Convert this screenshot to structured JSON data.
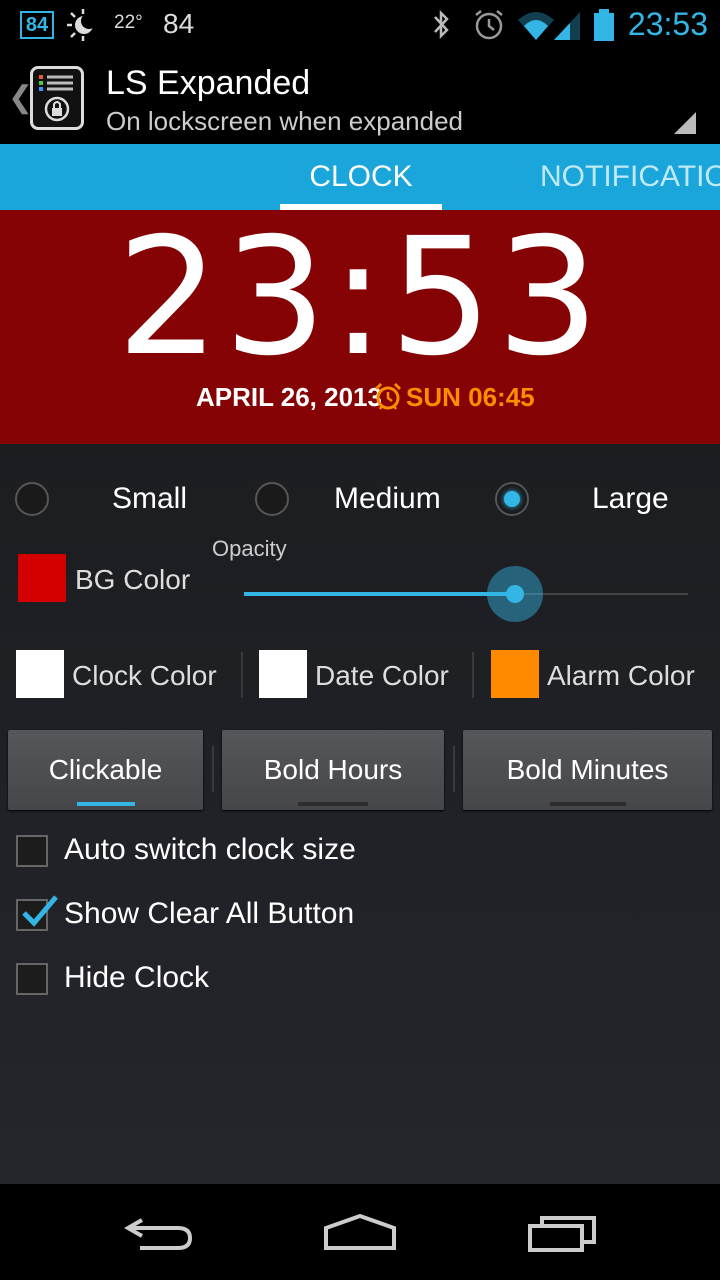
{
  "status_bar": {
    "badge": "84",
    "temperature": "22°",
    "number": "84",
    "time": "23:53",
    "icons": [
      "weather-night-icon",
      "bluetooth-icon",
      "alarm-icon",
      "wifi-icon",
      "signal-icon",
      "battery-icon"
    ]
  },
  "action_bar": {
    "title": "LS Expanded",
    "subtitle": "On lockscreen when expanded"
  },
  "tabs": [
    {
      "label": "CLOCK",
      "selected": true
    },
    {
      "label": "NOTIFICATIO",
      "selected": false
    }
  ],
  "preview": {
    "time": "23:53",
    "date": "APRIL 26, 2013",
    "alarm": "SUN 06:45",
    "bg_color": "#850305",
    "alarm_color": "#ff8c00"
  },
  "size_options": [
    {
      "label": "Small",
      "selected": false
    },
    {
      "label": "Medium",
      "selected": false
    },
    {
      "label": "Large",
      "selected": true
    }
  ],
  "bg_color": {
    "label": "BG Color",
    "swatch": "#d40000"
  },
  "opacity": {
    "label": "Opacity",
    "value": 0.61
  },
  "colors": [
    {
      "label": "Clock Color",
      "swatch": "#ffffff"
    },
    {
      "label": "Date Color",
      "swatch": "#ffffff"
    },
    {
      "label": "Alarm Color",
      "swatch": "#ff8a00"
    }
  ],
  "toggles": [
    {
      "label": "Clickable",
      "on": true
    },
    {
      "label": "Bold Hours",
      "on": false
    },
    {
      "label": "Bold Minutes",
      "on": false
    }
  ],
  "checkboxes": [
    {
      "label": "Auto switch clock size",
      "checked": false
    },
    {
      "label": "Show Clear All Button",
      "checked": true
    },
    {
      "label": "Hide Clock",
      "checked": false
    }
  ],
  "accent_color": "#33b5e5"
}
